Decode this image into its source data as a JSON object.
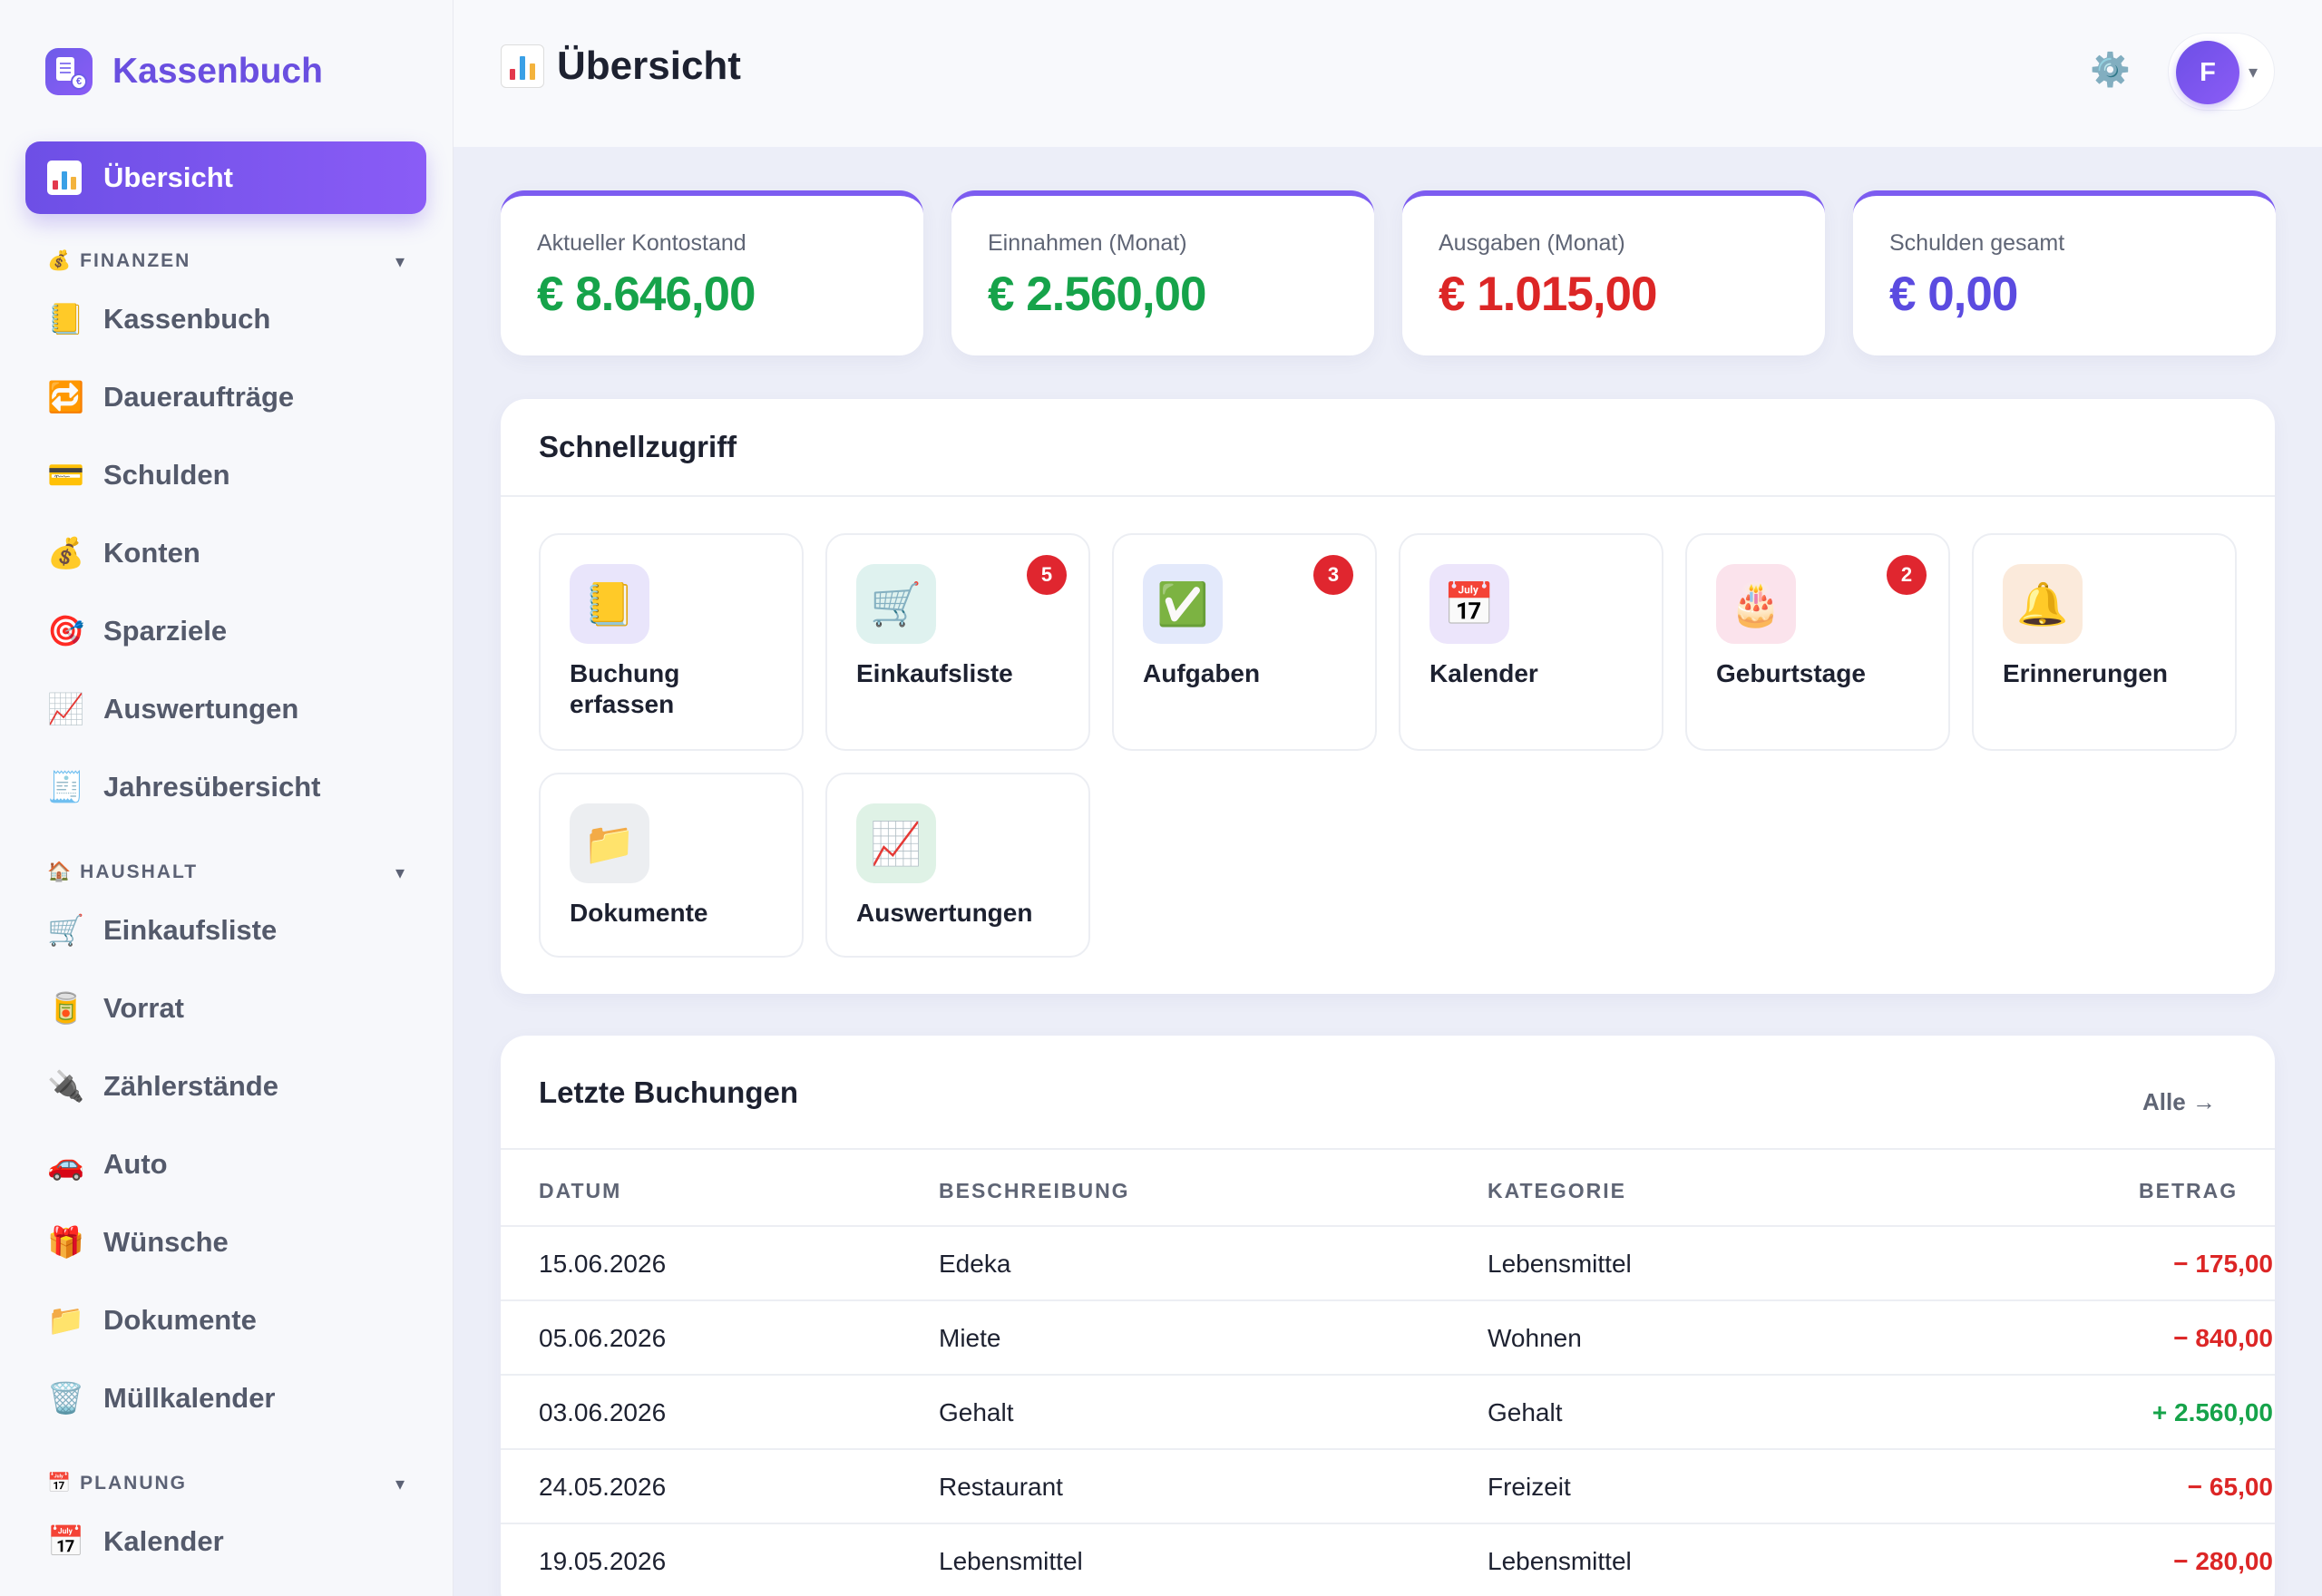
{
  "brand": {
    "name": "Kassenbuch",
    "logo_icon": "cashbook-logo-icon",
    "logo_glyph": "€"
  },
  "sidebar": {
    "active_item": {
      "label": "Übersicht",
      "icon": "bar-chart-icon"
    },
    "sections": [
      {
        "title": "FINANZEN",
        "icon": "💰",
        "chevron": "▾",
        "items": [
          {
            "label": "Kassenbuch",
            "icon": "📒"
          },
          {
            "label": "Daueraufträge",
            "icon": "🔁"
          },
          {
            "label": "Schulden",
            "icon": "💳"
          },
          {
            "label": "Konten",
            "icon": "💰"
          },
          {
            "label": "Sparziele",
            "icon": "🎯"
          },
          {
            "label": "Auswertungen",
            "icon": "📈"
          },
          {
            "label": "Jahresübersicht",
            "icon": "🧾"
          }
        ]
      },
      {
        "title": "HAUSHALT",
        "icon": "🏠",
        "chevron": "▾",
        "items": [
          {
            "label": "Einkaufsliste",
            "icon": "🛒"
          },
          {
            "label": "Vorrat",
            "icon": "🥫"
          },
          {
            "label": "Zählerstände",
            "icon": "🔌"
          },
          {
            "label": "Auto",
            "icon": "🚗"
          },
          {
            "label": "Wünsche",
            "icon": "🎁"
          },
          {
            "label": "Dokumente",
            "icon": "📁"
          },
          {
            "label": "Müllkalender",
            "icon": "🗑️"
          }
        ]
      },
      {
        "title": "PLANUNG",
        "icon": "📅",
        "chevron": "▾",
        "items": [
          {
            "label": "Kalender",
            "icon": "📅"
          }
        ]
      }
    ]
  },
  "header": {
    "title": "Übersicht",
    "settings_icon": "⚙️",
    "avatar_initial": "F",
    "caret": "▾"
  },
  "stats": [
    {
      "label": "Aktueller Kontostand",
      "value": "€ 8.646,00",
      "color": "#16a34a"
    },
    {
      "label": "Einnahmen (Monat)",
      "value": "€ 2.560,00",
      "color": "#16a34a"
    },
    {
      "label": "Ausgaben (Monat)",
      "value": "€ 1.015,00",
      "color": "#dc2626"
    },
    {
      "label": "Schulden gesamt",
      "value": "€ 0,00",
      "color": "#5b4be0"
    }
  ],
  "quick_access": {
    "title": "Schnellzugriff",
    "tiles": [
      {
        "label": "Buchung erfassen",
        "icon": "📒",
        "bg": "#e9e5fb",
        "badge": ""
      },
      {
        "label": "Einkaufsliste",
        "icon": "🛒",
        "bg": "#dff2ef",
        "badge": "5"
      },
      {
        "label": "Aufgaben",
        "icon": "✅",
        "bg": "#e3e9fb",
        "badge": "3"
      },
      {
        "label": "Kalender",
        "icon": "📅",
        "bg": "#ece5fb",
        "badge": ""
      },
      {
        "label": "Geburtstage",
        "icon": "🎂",
        "bg": "#fbe3ec",
        "badge": "2"
      },
      {
        "label": "Erinnerungen",
        "icon": "🔔",
        "bg": "#fbeadb",
        "badge": ""
      },
      {
        "label": "Dokumente",
        "icon": "📁",
        "bg": "#eceef1",
        "badge": ""
      },
      {
        "label": "Auswertungen",
        "icon": "📈",
        "bg": "#dff2e6",
        "badge": ""
      }
    ]
  },
  "recent": {
    "title": "Letzte Buchungen",
    "all_link": "Alle →",
    "columns": [
      "DATUM",
      "BESCHREIBUNG",
      "KATEGORIE",
      "BETRAG"
    ],
    "rows": [
      {
        "date": "15.06.2026",
        "desc": "Edeka",
        "cat": "Lebensmittel",
        "amount": "− 175,00",
        "sign": "neg"
      },
      {
        "date": "05.06.2026",
        "desc": "Miete",
        "cat": "Wohnen",
        "amount": "− 840,00",
        "sign": "neg"
      },
      {
        "date": "03.06.2026",
        "desc": "Gehalt",
        "cat": "Gehalt",
        "amount": "+ 2.560,00",
        "sign": "pos"
      },
      {
        "date": "24.05.2026",
        "desc": "Restaurant",
        "cat": "Freizeit",
        "amount": "− 65,00",
        "sign": "neg"
      },
      {
        "date": "19.05.2026",
        "desc": "Lebensmittel",
        "cat": "Lebensmittel",
        "amount": "− 280,00",
        "sign": "neg"
      }
    ]
  }
}
